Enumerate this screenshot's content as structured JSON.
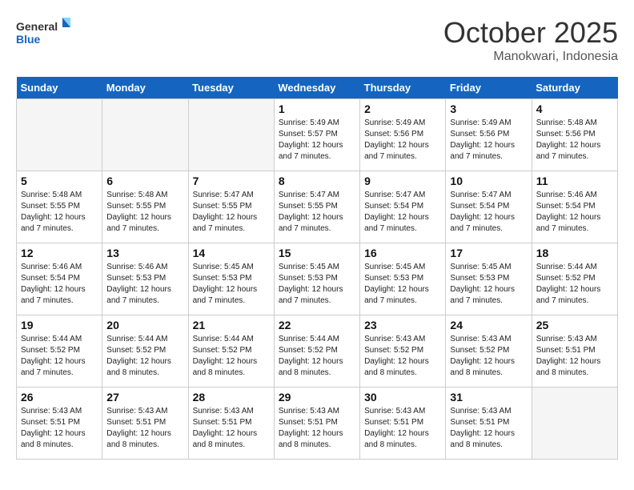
{
  "logo": {
    "line1": "General",
    "line2": "Blue"
  },
  "title": "October 2025",
  "location": "Manokwari, Indonesia",
  "days_of_week": [
    "Sunday",
    "Monday",
    "Tuesday",
    "Wednesday",
    "Thursday",
    "Friday",
    "Saturday"
  ],
  "weeks": [
    [
      {
        "day": "",
        "info": ""
      },
      {
        "day": "",
        "info": ""
      },
      {
        "day": "",
        "info": ""
      },
      {
        "day": "1",
        "info": "Sunrise: 5:49 AM\nSunset: 5:57 PM\nDaylight: 12 hours\nand 7 minutes."
      },
      {
        "day": "2",
        "info": "Sunrise: 5:49 AM\nSunset: 5:56 PM\nDaylight: 12 hours\nand 7 minutes."
      },
      {
        "day": "3",
        "info": "Sunrise: 5:49 AM\nSunset: 5:56 PM\nDaylight: 12 hours\nand 7 minutes."
      },
      {
        "day": "4",
        "info": "Sunrise: 5:48 AM\nSunset: 5:56 PM\nDaylight: 12 hours\nand 7 minutes."
      }
    ],
    [
      {
        "day": "5",
        "info": "Sunrise: 5:48 AM\nSunset: 5:55 PM\nDaylight: 12 hours\nand 7 minutes."
      },
      {
        "day": "6",
        "info": "Sunrise: 5:48 AM\nSunset: 5:55 PM\nDaylight: 12 hours\nand 7 minutes."
      },
      {
        "day": "7",
        "info": "Sunrise: 5:47 AM\nSunset: 5:55 PM\nDaylight: 12 hours\nand 7 minutes."
      },
      {
        "day": "8",
        "info": "Sunrise: 5:47 AM\nSunset: 5:55 PM\nDaylight: 12 hours\nand 7 minutes."
      },
      {
        "day": "9",
        "info": "Sunrise: 5:47 AM\nSunset: 5:54 PM\nDaylight: 12 hours\nand 7 minutes."
      },
      {
        "day": "10",
        "info": "Sunrise: 5:47 AM\nSunset: 5:54 PM\nDaylight: 12 hours\nand 7 minutes."
      },
      {
        "day": "11",
        "info": "Sunrise: 5:46 AM\nSunset: 5:54 PM\nDaylight: 12 hours\nand 7 minutes."
      }
    ],
    [
      {
        "day": "12",
        "info": "Sunrise: 5:46 AM\nSunset: 5:54 PM\nDaylight: 12 hours\nand 7 minutes."
      },
      {
        "day": "13",
        "info": "Sunrise: 5:46 AM\nSunset: 5:53 PM\nDaylight: 12 hours\nand 7 minutes."
      },
      {
        "day": "14",
        "info": "Sunrise: 5:45 AM\nSunset: 5:53 PM\nDaylight: 12 hours\nand 7 minutes."
      },
      {
        "day": "15",
        "info": "Sunrise: 5:45 AM\nSunset: 5:53 PM\nDaylight: 12 hours\nand 7 minutes."
      },
      {
        "day": "16",
        "info": "Sunrise: 5:45 AM\nSunset: 5:53 PM\nDaylight: 12 hours\nand 7 minutes."
      },
      {
        "day": "17",
        "info": "Sunrise: 5:45 AM\nSunset: 5:53 PM\nDaylight: 12 hours\nand 7 minutes."
      },
      {
        "day": "18",
        "info": "Sunrise: 5:44 AM\nSunset: 5:52 PM\nDaylight: 12 hours\nand 7 minutes."
      }
    ],
    [
      {
        "day": "19",
        "info": "Sunrise: 5:44 AM\nSunset: 5:52 PM\nDaylight: 12 hours\nand 7 minutes."
      },
      {
        "day": "20",
        "info": "Sunrise: 5:44 AM\nSunset: 5:52 PM\nDaylight: 12 hours\nand 8 minutes."
      },
      {
        "day": "21",
        "info": "Sunrise: 5:44 AM\nSunset: 5:52 PM\nDaylight: 12 hours\nand 8 minutes."
      },
      {
        "day": "22",
        "info": "Sunrise: 5:44 AM\nSunset: 5:52 PM\nDaylight: 12 hours\nand 8 minutes."
      },
      {
        "day": "23",
        "info": "Sunrise: 5:43 AM\nSunset: 5:52 PM\nDaylight: 12 hours\nand 8 minutes."
      },
      {
        "day": "24",
        "info": "Sunrise: 5:43 AM\nSunset: 5:52 PM\nDaylight: 12 hours\nand 8 minutes."
      },
      {
        "day": "25",
        "info": "Sunrise: 5:43 AM\nSunset: 5:51 PM\nDaylight: 12 hours\nand 8 minutes."
      }
    ],
    [
      {
        "day": "26",
        "info": "Sunrise: 5:43 AM\nSunset: 5:51 PM\nDaylight: 12 hours\nand 8 minutes."
      },
      {
        "day": "27",
        "info": "Sunrise: 5:43 AM\nSunset: 5:51 PM\nDaylight: 12 hours\nand 8 minutes."
      },
      {
        "day": "28",
        "info": "Sunrise: 5:43 AM\nSunset: 5:51 PM\nDaylight: 12 hours\nand 8 minutes."
      },
      {
        "day": "29",
        "info": "Sunrise: 5:43 AM\nSunset: 5:51 PM\nDaylight: 12 hours\nand 8 minutes."
      },
      {
        "day": "30",
        "info": "Sunrise: 5:43 AM\nSunset: 5:51 PM\nDaylight: 12 hours\nand 8 minutes."
      },
      {
        "day": "31",
        "info": "Sunrise: 5:43 AM\nSunset: 5:51 PM\nDaylight: 12 hours\nand 8 minutes."
      },
      {
        "day": "",
        "info": ""
      }
    ]
  ]
}
